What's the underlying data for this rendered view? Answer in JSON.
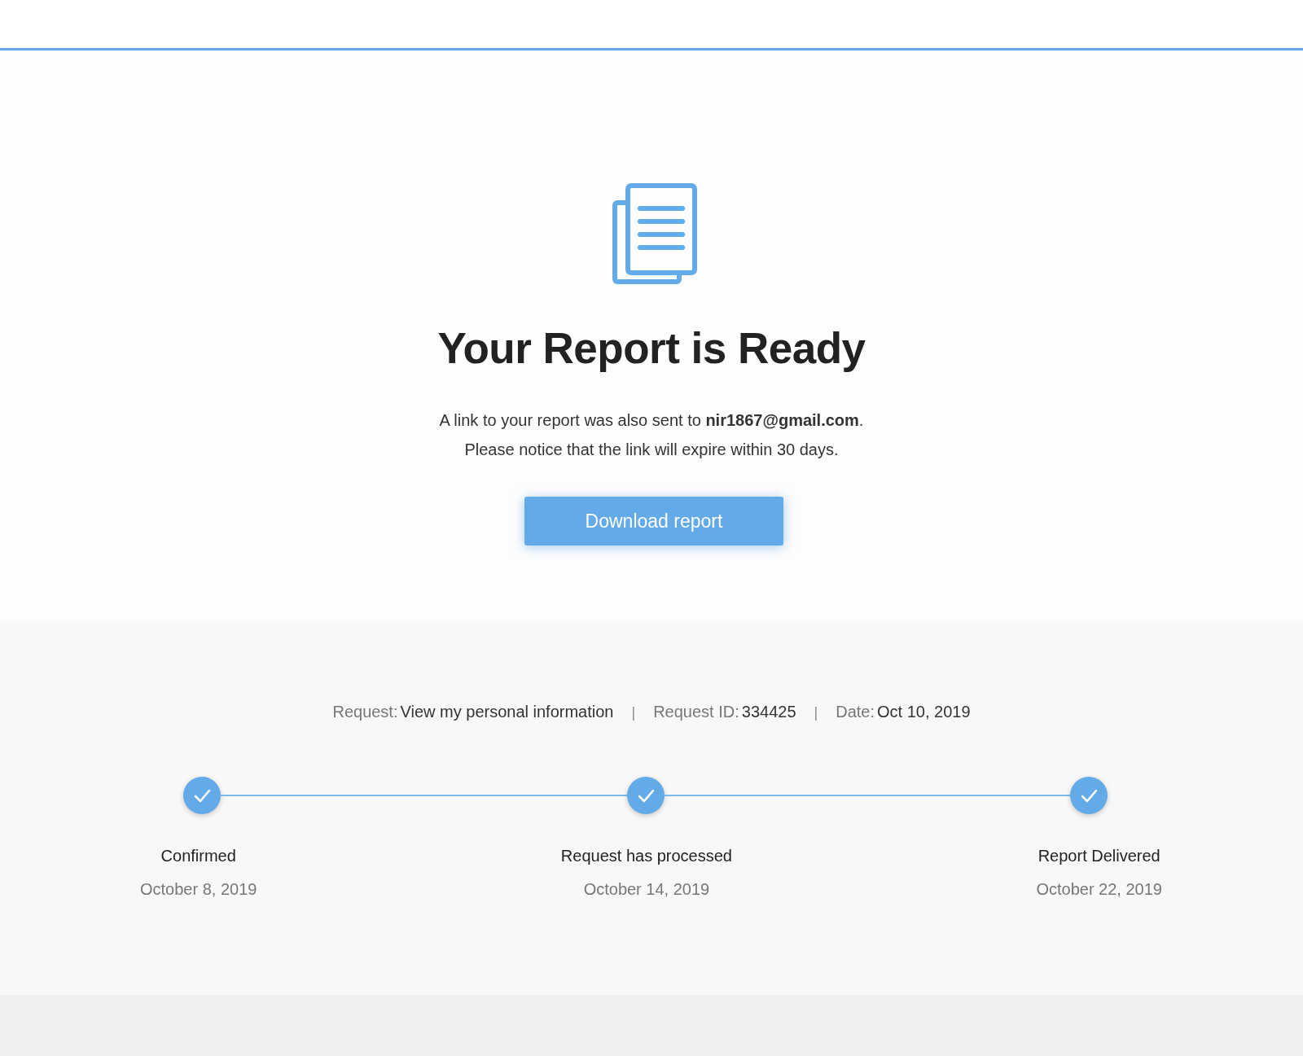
{
  "title": "Your Report is Ready",
  "message": [
    "A link to your report was also sent to **nir1867@gmail.com**.",
    "Please notice that the link will expire within 30 days."
  ],
  "button": {
    "label": "Download report"
  },
  "request_info": {
    "separator": "|",
    "items": [
      {
        "label": "Request:",
        "value": "View my personal information"
      },
      {
        "label": "Request ID:",
        "value": "334425"
      },
      {
        "label": "Date:",
        "value": "Oct 10, 2019"
      }
    ]
  },
  "steps": [
    {
      "label": "Confirmed",
      "date": "October 8, 2019",
      "done": true
    },
    {
      "label": "Request has processed",
      "date": "October 14, 2019",
      "done": true
    },
    {
      "label": "Report Delivered",
      "date": "October 22, 2019",
      "done": true
    }
  ]
}
